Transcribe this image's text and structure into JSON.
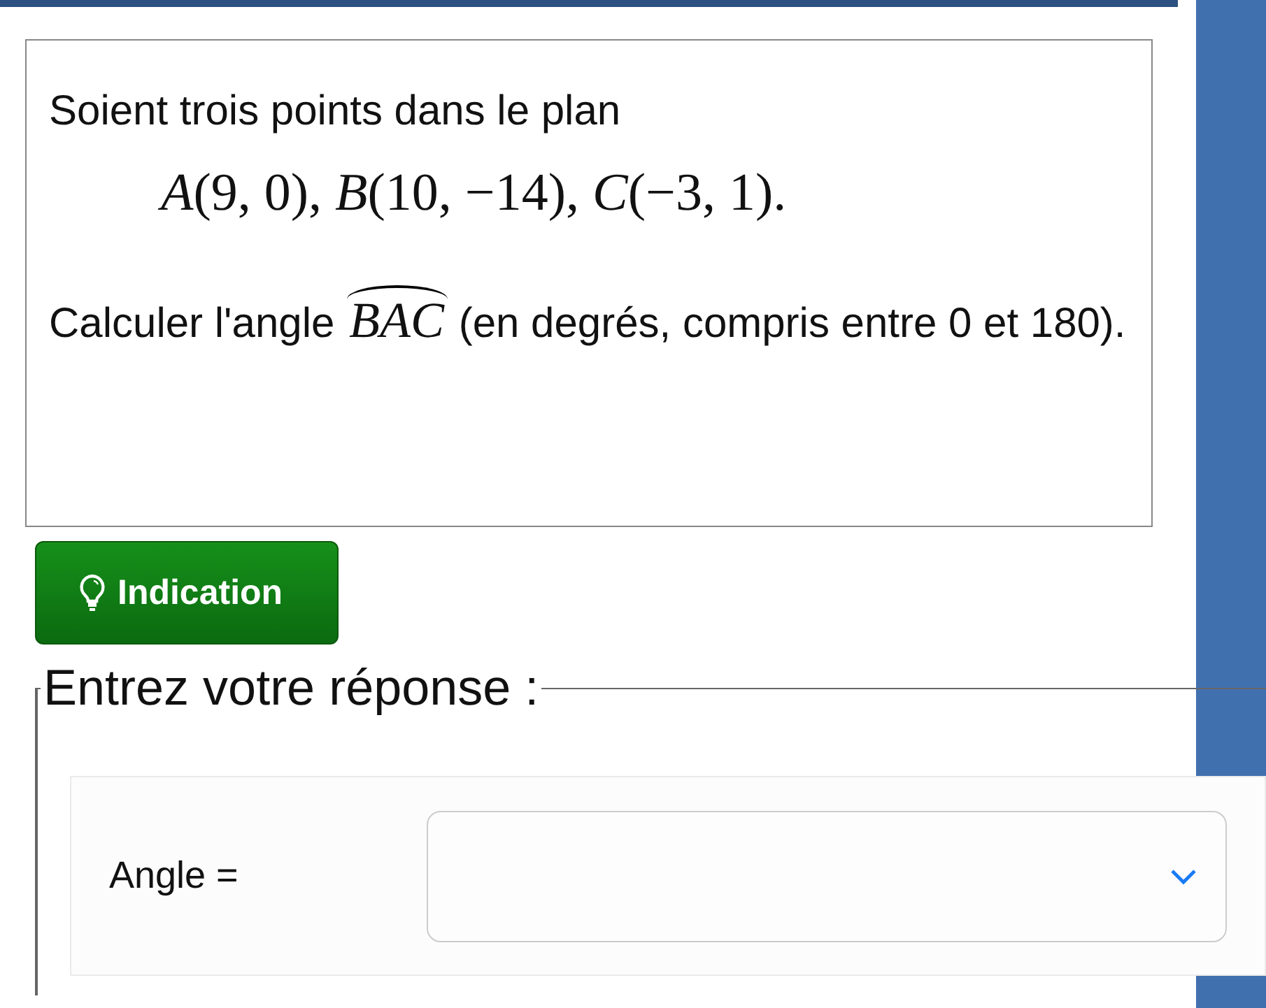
{
  "exercise": {
    "intro": "Soient trois points dans le plan",
    "points": "*A*(9, 0), *B*(10, −14), *C*(−3, 1).",
    "question_before": "Calculer l'angle ",
    "angle": "*BAC*",
    "question_after": " (en degrés, compris entre 0 et 180)."
  },
  "hint_button": {
    "label": "Indication"
  },
  "answer": {
    "legend": "Entrez votre réponse :",
    "label": "Angle =",
    "dropdown": {
      "expanded": false
    }
  }
}
